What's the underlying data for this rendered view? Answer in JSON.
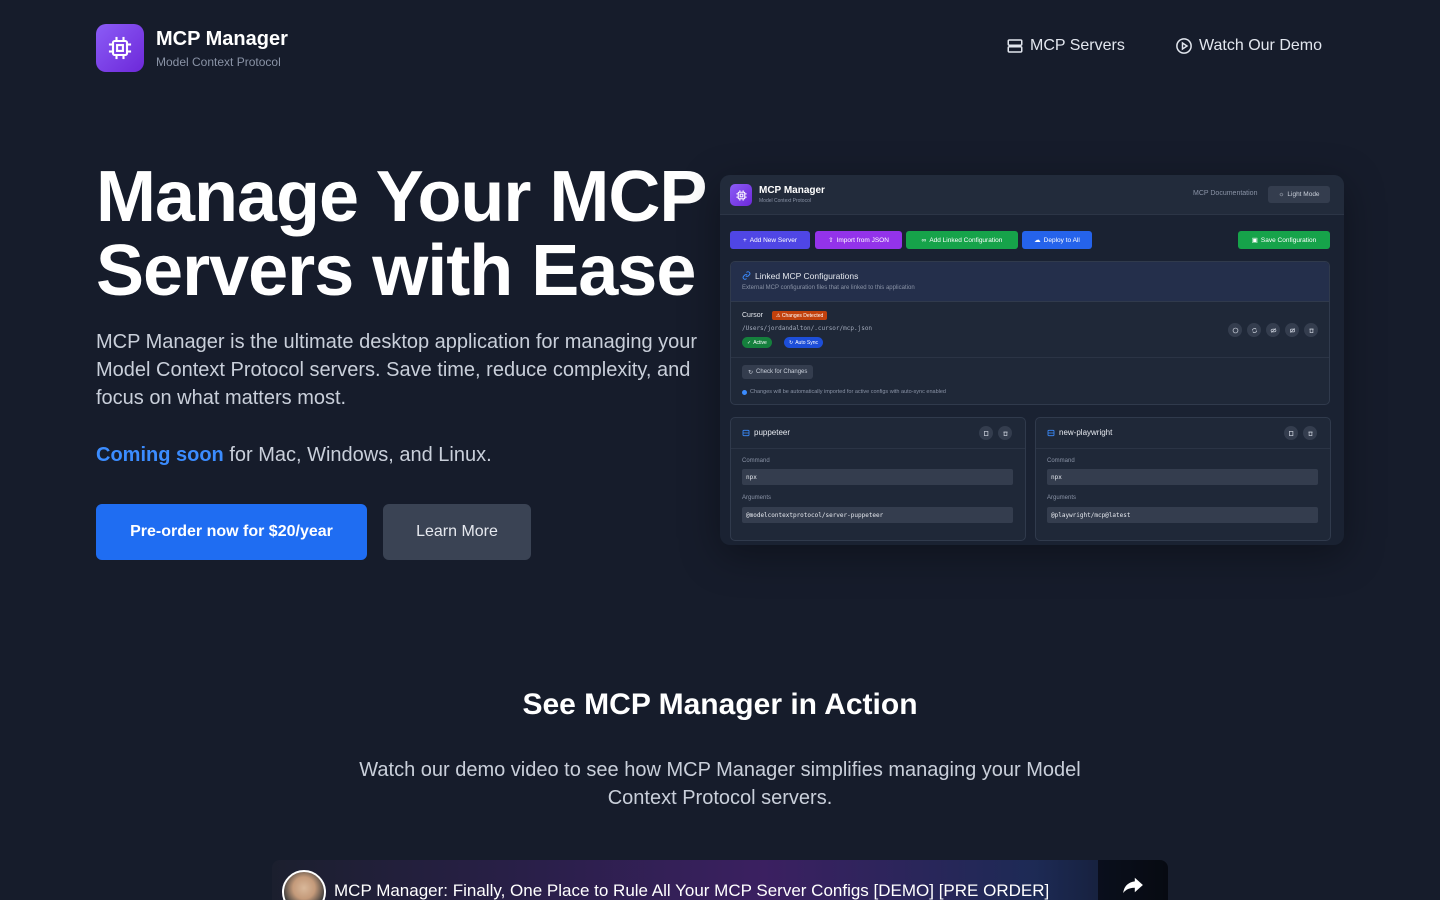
{
  "header": {
    "brand_title": "MCP Manager",
    "brand_subtitle": "Model Context Protocol",
    "nav": [
      {
        "label": "MCP Servers",
        "icon": "server-icon"
      },
      {
        "label": "Watch Our Demo",
        "icon": "play-circle-icon"
      }
    ]
  },
  "hero": {
    "title_line1": "Manage Your MCP",
    "title_line2": "Servers with Ease",
    "description": "MCP Manager is the ultimate desktop application for managing your Model Context Protocol servers. Save time, reduce complexity, and focus on what matters most.",
    "coming_highlight": "Coming soon",
    "coming_rest": " for Mac, Windows, and Linux.",
    "primary_button": "Pre-order now for $20/year",
    "secondary_button": "Learn More"
  },
  "preview": {
    "title": "MCP Manager",
    "subtitle": "Model Context Protocol",
    "doc_link": "MCP Documentation",
    "light_mode": "Light Mode",
    "toolbar": {
      "add": "Add New Server",
      "import": "Import from JSON",
      "link": "Add Linked Configuration",
      "deploy": "Deploy to All",
      "save": "Save Configuration"
    },
    "linked": {
      "title": "Linked MCP Configurations",
      "subtitle": "External MCP configuration files that are linked to this application",
      "cursor_label": "Cursor",
      "changes_badge": "Changes Detected",
      "cursor_path": "/Users/jordandalton/.cursor/mcp.json",
      "active_badge": "Active",
      "sync_badge": "Auto Sync",
      "check_button": "Check for Changes",
      "auto_note": "Changes will be automatically imported for active configs with auto-sync enabled"
    },
    "servers": [
      {
        "name": "puppeteer",
        "command_label": "Command",
        "command": "npx",
        "args_label": "Arguments",
        "args": "@modelcontextprotocol/server-puppeteer"
      },
      {
        "name": "new-playwright",
        "command_label": "Command",
        "command": "npx",
        "args_label": "Arguments",
        "args": "@playwright/mcp@latest"
      }
    ]
  },
  "section": {
    "title": "See MCP Manager in Action",
    "description": "Watch our demo video to see how MCP Manager simplifies managing your Model Context Protocol servers."
  },
  "video": {
    "title": "MCP Manager: Finally, One Place to Rule All Your MCP Server Configs [DEMO] [PRE ORDER]"
  },
  "colors": {
    "background": "#161c2b",
    "primary": "#1f6df2",
    "accent_link": "#3b8cff",
    "brand_purple": "#7c3aed"
  }
}
